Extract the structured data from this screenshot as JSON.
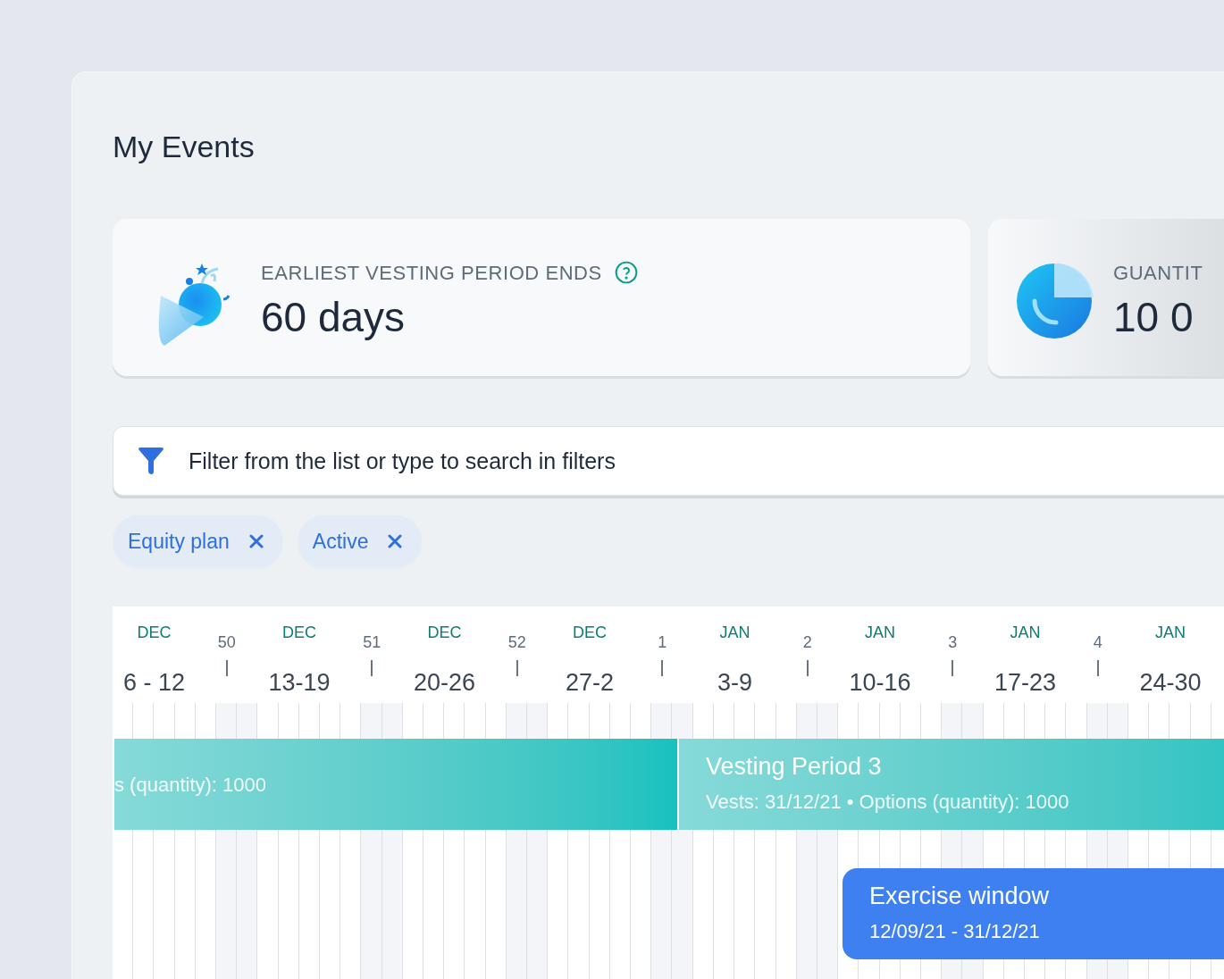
{
  "page": {
    "title": "My Events"
  },
  "cards": [
    {
      "kind": "popper",
      "label": "EARLIEST VESTING PERIOD ENDS",
      "help": true,
      "value": "60 days"
    },
    {
      "kind": "pie",
      "label": "GUANTIT",
      "help": false,
      "value": "10 0"
    }
  ],
  "filter": {
    "placeholder": "Filter from the list or type to search in filters"
  },
  "chips": [
    {
      "label": "Equity plan"
    },
    {
      "label": "Active"
    }
  ],
  "timeline": {
    "weeks": [
      {
        "month": "DEC",
        "range": "6 - 12",
        "number": "50"
      },
      {
        "month": "DEC",
        "range": "13-19",
        "number": "51"
      },
      {
        "month": "DEC",
        "range": "20-26",
        "number": "52"
      },
      {
        "month": "DEC",
        "range": "27-2",
        "number": "1"
      },
      {
        "month": "JAN",
        "range": "3-9",
        "number": "2"
      },
      {
        "month": "JAN",
        "range": "10-16",
        "number": "3"
      },
      {
        "month": "JAN",
        "range": "17-23",
        "number": "4"
      },
      {
        "month": "JAN",
        "range": "24-30"
      }
    ],
    "events": [
      {
        "kind": "vesting",
        "subtitle": "s (quantity): 1000"
      },
      {
        "kind": "vesting",
        "title": "Vesting Period 3",
        "subtitle": "Vests: 31/12/21 • Options (quantity): 1000"
      },
      {
        "kind": "exercise",
        "title": "Exercise window",
        "subtitle": "12/09/21 - 31/12/21"
      }
    ]
  }
}
